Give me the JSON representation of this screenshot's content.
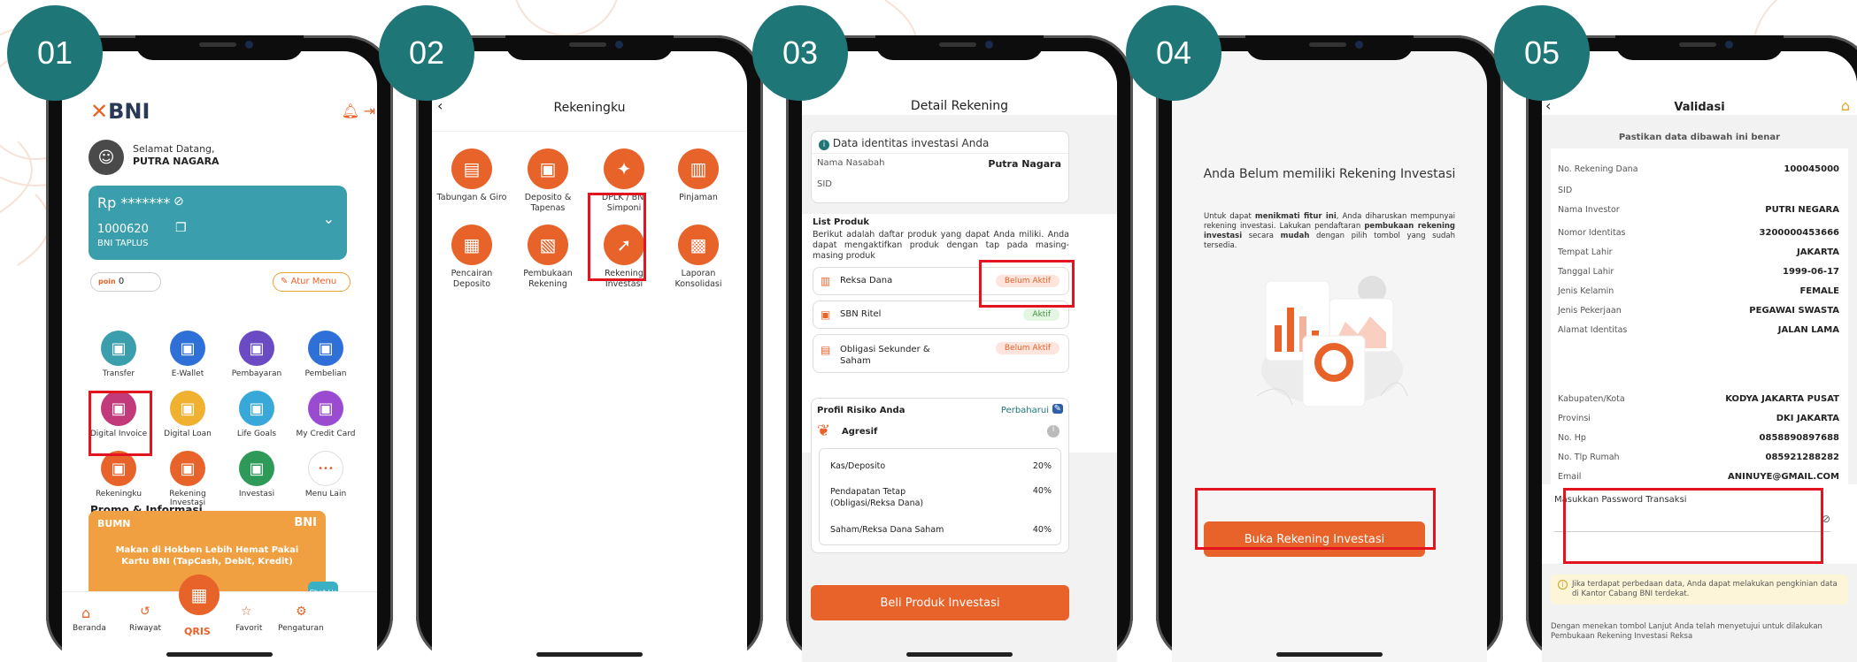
{
  "steps": [
    "01",
    "02",
    "03",
    "04",
    "05"
  ],
  "screen1": {
    "logo": "BNI",
    "greeting": "Selamat Datang,",
    "user_name": "PUTRA NAGARA",
    "balance_masked": "Rp *******",
    "account_number": "1000620",
    "account_type": "BNI TAPLUS",
    "points_label": "poin",
    "points_value": "0",
    "atur_menu": "Atur Menu",
    "menu": [
      {
        "label": "Transfer",
        "icon": "transfer-icon",
        "color": "#3a9eac"
      },
      {
        "label": "E-Wallet",
        "icon": "wallet-icon",
        "color": "#2e6fd8"
      },
      {
        "label": "Pembayaran",
        "icon": "payment-icon",
        "color": "#6a4bc4"
      },
      {
        "label": "Pembelian",
        "icon": "cart-icon",
        "color": "#2e6fd8"
      },
      {
        "label": "Digital Invoice",
        "icon": "invoice-icon",
        "color": "#c23a7a"
      },
      {
        "label": "Digital Loan",
        "icon": "loan-icon",
        "color": "#f0b030"
      },
      {
        "label": "Life Goals",
        "icon": "goals-icon",
        "color": "#38a8d8"
      },
      {
        "label": "My Credit Card",
        "icon": "credit-card-icon",
        "color": "#9a4bd0"
      },
      {
        "label": "Rekeningku",
        "icon": "account-icon",
        "color": "#e8632a"
      },
      {
        "label": "Rekening Investasi",
        "icon": "investment-account-icon",
        "color": "#e8632a"
      },
      {
        "label": "Investasi",
        "icon": "investment-icon",
        "color": "#2e9a5a"
      },
      {
        "label": "Menu Lain",
        "icon": "more-icon",
        "color": "#ffffff"
      }
    ],
    "promo_title": "Promo & Informasi",
    "promo_text": "Makan di Hokben Lebih Hemat Pakai Kartu BNI (TapCash, Debit, Kredit)",
    "promo_brand": "BUMN",
    "chat_us": "Chat Us",
    "nav": [
      "Beranda",
      "Riwayat",
      "QRIS",
      "Favorit",
      "Pengaturan"
    ]
  },
  "screen2": {
    "title": "Rekeningku",
    "items": [
      {
        "label": "Tabungan & Giro",
        "icon": "savings-icon"
      },
      {
        "label": "Deposito & Tapenas",
        "icon": "deposit-icon"
      },
      {
        "label": "DPLK / BNI Simponi",
        "icon": "pension-icon"
      },
      {
        "label": "Pinjaman",
        "icon": "loan-icon"
      },
      {
        "label": "Pencairan Deposito",
        "icon": "withdraw-deposit-icon"
      },
      {
        "label": "Pembukaan Rekening",
        "icon": "open-account-icon"
      },
      {
        "label": "Rekening Investasi",
        "icon": "investment-account-icon"
      },
      {
        "label": "Laporan Konsolidasi",
        "icon": "report-icon"
      }
    ]
  },
  "screen3": {
    "title": "Detail Rekening",
    "identity_title": "Data identitas investasi Anda",
    "nama_nasabah_label": "Nama Nasabah",
    "nama_nasabah_value": "Putra Nagara",
    "sid_label": "SID",
    "list_produk_title": "List Produk",
    "list_produk_desc": "Berikut adalah daftar produk yang dapat Anda miliki. Anda dapat mengaktifkan produk dengan tap pada masing-masing produk",
    "products": [
      {
        "name": "Reksa Dana",
        "status": "Belum Aktif"
      },
      {
        "name": "SBN Ritel",
        "status": "Aktif"
      },
      {
        "name": "Obligasi Sekunder & Saham",
        "status": "Belum Aktif"
      }
    ],
    "profil_title": "Profil Risiko Anda",
    "perbaharui": "Perbaharui",
    "risk_level": "Agresif",
    "allocations": [
      {
        "label": "Kas/Deposito",
        "value": "20%"
      },
      {
        "label": "Pendapatan Tetap (Obligasi/Reksa Dana)",
        "value": "40%"
      },
      {
        "label": "Saham/Reksa Dana Saham",
        "value": "40%"
      }
    ],
    "buy_button": "Beli Produk Investasi"
  },
  "screen4": {
    "heading": "Anda Belum memiliki Rekening Investasi",
    "desc_1": "Untuk dapat ",
    "desc_b1": "menikmati fitur ini",
    "desc_2": ", Anda diharuskan mempunyai rekening investasi. Lakukan pendaftaran ",
    "desc_b2": "pembukaan rekening investasi",
    "desc_3": " secara ",
    "desc_b3": "mudah",
    "desc_4": " dengan pilih tombol yang sudah tersedia.",
    "button": "Buka Rekening Investasi"
  },
  "screen5": {
    "title": "Validasi",
    "subtitle": "Pastikan data dibawah ini benar",
    "fields": [
      {
        "label": "No. Rekening Dana",
        "value": "100045000"
      },
      {
        "label": "SID",
        "value": ""
      },
      {
        "label": "Nama Investor",
        "value": "PUTRI NEGARA"
      },
      {
        "label": "Nomor Identitas",
        "value": "3200000453666"
      },
      {
        "label": "Tempat Lahir",
        "value": "JAKARTA"
      },
      {
        "label": "Tanggal Lahir",
        "value": "1999-06-17"
      },
      {
        "label": "Jenis Kelamin",
        "value": "FEMALE"
      },
      {
        "label": "Jenis Pekerjaan",
        "value": "PEGAWAI SWASTA"
      },
      {
        "label": "Alamat Identitas",
        "value": "JALAN LAMA"
      },
      {
        "label": "Kabupaten/Kota",
        "value": "KODYA JAKARTA PUSAT"
      },
      {
        "label": "Provinsi",
        "value": "DKI JAKARTA"
      },
      {
        "label": "No. Hp",
        "value": "0858890897688"
      },
      {
        "label": "No. Tlp Rumah",
        "value": "085921288282"
      },
      {
        "label": "Email",
        "value": "ANINUYE@GMAIL.COM"
      }
    ],
    "password_label": "Masukkan Password Transaksi",
    "info_text": "Jika terdapat perbedaan data, Anda dapat melakukan pengkinian data di Kantor Cabang BNI terdekat.",
    "footer_text": "Dengan menekan tombol Lanjut Anda telah menyetujui untuk dilakukan Pembukaan Rekening Investasi Reksa"
  }
}
